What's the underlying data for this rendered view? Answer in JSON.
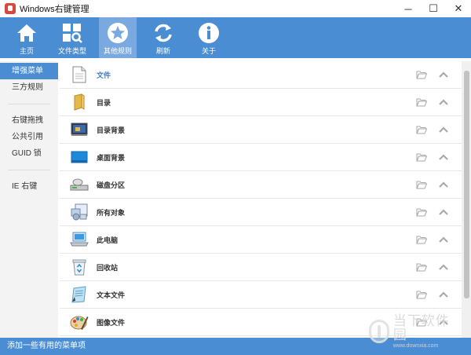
{
  "window": {
    "title": "Windows右键管理",
    "minimize": "─",
    "maximize": "☐",
    "close": "✕"
  },
  "toolbar": {
    "items": [
      {
        "label": "主页",
        "icon": "home-icon"
      },
      {
        "label": "文件类型",
        "icon": "file-types-icon"
      },
      {
        "label": "其他规则",
        "icon": "star-icon",
        "active": true
      },
      {
        "label": "刷新",
        "icon": "refresh-icon"
      },
      {
        "label": "关于",
        "icon": "info-icon"
      }
    ]
  },
  "sidebar": {
    "items": [
      {
        "label": "增强菜单",
        "active": true
      },
      {
        "label": "三方规则"
      },
      {
        "label": "右键拖拽"
      },
      {
        "label": "公共引用"
      },
      {
        "label": "GUID 锁"
      },
      {
        "label": "IE 右键"
      }
    ]
  },
  "main": {
    "rows": [
      {
        "label": "文件",
        "icon": "document-icon",
        "selected": true
      },
      {
        "label": "目录",
        "icon": "folder-icon"
      },
      {
        "label": "目录背景",
        "icon": "folder-background-icon"
      },
      {
        "label": "桌面背景",
        "icon": "desktop-background-icon"
      },
      {
        "label": "磁盘分区",
        "icon": "drive-icon"
      },
      {
        "label": "所有对象",
        "icon": "all-objects-icon"
      },
      {
        "label": "此电脑",
        "icon": "computer-icon"
      },
      {
        "label": "回收站",
        "icon": "recycle-bin-icon"
      },
      {
        "label": "文本文件",
        "icon": "text-file-icon"
      },
      {
        "label": "图像文件",
        "icon": "image-file-icon"
      }
    ]
  },
  "statusbar": {
    "text": "添加一些有用的菜单项"
  },
  "watermark": {
    "cn": "当下软件园",
    "en": "www.downxia.com"
  },
  "colors": {
    "accent": "#4a8dd3",
    "selected_text": "#3b7fd0"
  }
}
